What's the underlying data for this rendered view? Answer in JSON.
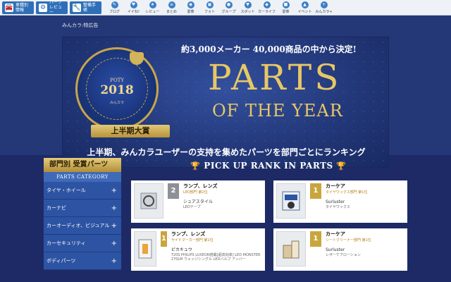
{
  "topnav": {
    "big_buttons": [
      {
        "icon": "car-icon",
        "glyph": "🚘",
        "label": "車種別情報"
      },
      {
        "icon": "parts-review-icon",
        "glyph": "⚙",
        "label": "パーツレビュー"
      },
      {
        "icon": "wrench-icon",
        "glyph": "🔧",
        "label": "整備手帳"
      }
    ],
    "small_items": [
      {
        "icon": "blog-icon",
        "label": "ブログ"
      },
      {
        "icon": "like-icon",
        "label": "イイね!"
      },
      {
        "icon": "review-icon",
        "label": "レビュー"
      },
      {
        "icon": "summary-icon",
        "label": "まとめ"
      },
      {
        "icon": "used-car-icon",
        "label": "愛車"
      },
      {
        "icon": "photo-icon",
        "label": "フォト"
      },
      {
        "icon": "group-icon",
        "label": "グループ"
      },
      {
        "icon": "spot-icon",
        "label": "スポット"
      },
      {
        "icon": "car-life-icon",
        "label": "カーライフ"
      },
      {
        "icon": "garage-icon",
        "label": "愛車"
      },
      {
        "icon": "event-icon",
        "label": "イベント"
      },
      {
        "icon": "minkara-icon",
        "label": "みんカラ+"
      }
    ]
  },
  "banner": {
    "brand": "みんカラ:特広告",
    "badge": {
      "poty": "POTY",
      "year": "2018",
      "ribbon": "上半期大賞",
      "sub": "みんカラ"
    },
    "tagline": "約3,000メーカー 40,000商品の中から決定!",
    "title_line1": "PARTS",
    "title_line2": "OF THE YEAR",
    "subline": "上半期、みんカラユーザーの支持を集めたパーツを部門ごとにランキング"
  },
  "sidebar": {
    "heading": "部門別 受賞パーツ",
    "category_label": "PARTS CATEGORY",
    "items": [
      {
        "label": "タイヤ・ホイール"
      },
      {
        "label": "カーナビ"
      },
      {
        "label": "カーオーディオ、ビジュアル"
      },
      {
        "label": "カーセキュリティ"
      },
      {
        "label": "ボディパーツ"
      }
    ]
  },
  "main": {
    "pickup_title": "PICK UP RANK IN PARTS",
    "cards": [
      {
        "rank": "2",
        "rank_color": "#8d9097",
        "category": "ランプ、レンズ",
        "subcat": "LED部門 第2位",
        "brand": "シュアスタイル",
        "product": "LEDテープ",
        "thumb_icon": "led-tape-icon"
      },
      {
        "rank": "1",
        "rank_color": "#c9a53e",
        "category": "カーケア",
        "subcat": "タイヤワックス部門 第1位",
        "brand": "Surluster",
        "product": "タイヤワックス",
        "thumb_icon": "tire-wax-box-icon"
      },
      {
        "rank": "1",
        "rank_color": "#c9a53e",
        "category": "ランプ、レンズ",
        "subcat": "サイドマーカー部門 第1位",
        "brand": "ピカキュウ",
        "product": "T20S PHILIPS LUXEON搭載[超高効率] LED MONSTER 270LM ウェッジシングル LEDバルブ アンバー",
        "thumb_icon": "led-bulb-icon"
      },
      {
        "rank": "1",
        "rank_color": "#c9a53e",
        "category": "カーケア",
        "subcat": "シートクリーナー部門 第1位",
        "brand": "Surluster",
        "product": "レザーケアローション",
        "thumb_icon": "leather-care-icon"
      }
    ]
  }
}
